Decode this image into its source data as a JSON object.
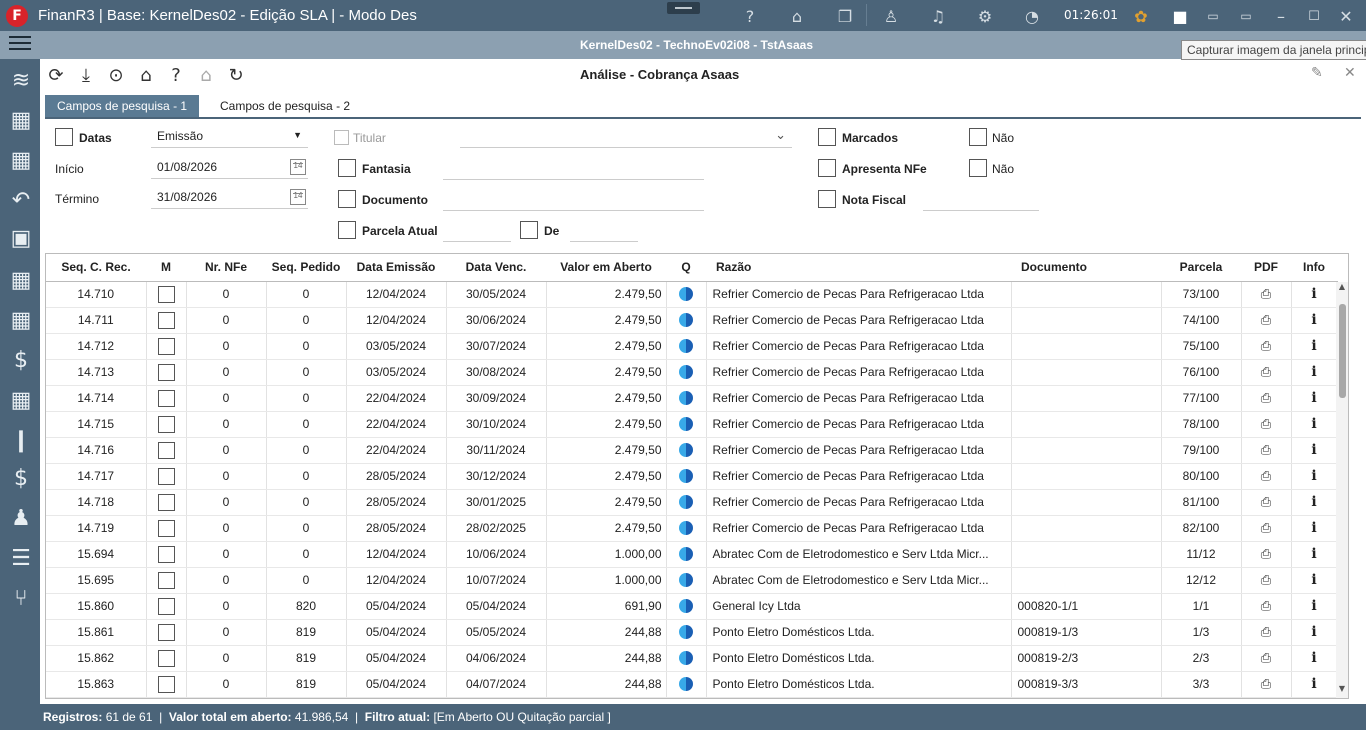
{
  "titlebar": {
    "app_title": "FinanR3 | Base: KernelDes02 - Edição SLA | - Modo Des",
    "logo_letter": "F",
    "clock": "01:26:01"
  },
  "subbar": {
    "title": "KernelDes02 - TechnoEv02i08 - TstAsaas",
    "tooltip": "Capturar imagem da janela principal"
  },
  "window": {
    "title": "Análise - Cobrança Asaas"
  },
  "tabs": [
    {
      "label": "Campos de pesquisa - 1"
    },
    {
      "label": "Campos de pesquisa - 2"
    }
  ],
  "filters": {
    "datas_label": "Datas",
    "date_type": "Emissão",
    "inicio_label": "Início",
    "inicio_value": "01/08/2026",
    "termino_label": "Término",
    "termino_value": "31/08/2026",
    "titular_label": "Titular",
    "fantasia_label": "Fantasia",
    "documento_label": "Documento",
    "parcela_label": "Parcela Atual",
    "de_label": "De",
    "marcados_label": "Marcados",
    "apresenta_label": "Apresenta NFe",
    "nota_label": "Nota Fiscal",
    "nao1_label": "Não",
    "nao2_label": "Não"
  },
  "grid": {
    "columns": [
      "Seq. C. Rec.",
      "M",
      "Nr. NFe",
      "Seq. Pedido",
      "Data Emissão",
      "Data Venc.",
      "Valor em Aberto",
      "Q",
      "Razão",
      "Documento",
      "Parcela",
      "PDF",
      "Info"
    ],
    "rows": [
      [
        "14.710",
        "0",
        "0",
        "12/04/2024",
        "30/05/2024",
        "2.479,50",
        "Refrier Comercio de Pecas Para Refrigeracao Ltda",
        "",
        "73/100"
      ],
      [
        "14.711",
        "0",
        "0",
        "12/04/2024",
        "30/06/2024",
        "2.479,50",
        "Refrier Comercio de Pecas Para Refrigeracao Ltda",
        "",
        "74/100"
      ],
      [
        "14.712",
        "0",
        "0",
        "03/05/2024",
        "30/07/2024",
        "2.479,50",
        "Refrier Comercio de Pecas Para Refrigeracao Ltda",
        "",
        "75/100"
      ],
      [
        "14.713",
        "0",
        "0",
        "03/05/2024",
        "30/08/2024",
        "2.479,50",
        "Refrier Comercio de Pecas Para Refrigeracao Ltda",
        "",
        "76/100"
      ],
      [
        "14.714",
        "0",
        "0",
        "22/04/2024",
        "30/09/2024",
        "2.479,50",
        "Refrier Comercio de Pecas Para Refrigeracao Ltda",
        "",
        "77/100"
      ],
      [
        "14.715",
        "0",
        "0",
        "22/04/2024",
        "30/10/2024",
        "2.479,50",
        "Refrier Comercio de Pecas Para Refrigeracao Ltda",
        "",
        "78/100"
      ],
      [
        "14.716",
        "0",
        "0",
        "22/04/2024",
        "30/11/2024",
        "2.479,50",
        "Refrier Comercio de Pecas Para Refrigeracao Ltda",
        "",
        "79/100"
      ],
      [
        "14.717",
        "0",
        "0",
        "28/05/2024",
        "30/12/2024",
        "2.479,50",
        "Refrier Comercio de Pecas Para Refrigeracao Ltda",
        "",
        "80/100"
      ],
      [
        "14.718",
        "0",
        "0",
        "28/05/2024",
        "30/01/2025",
        "2.479,50",
        "Refrier Comercio de Pecas Para Refrigeracao Ltda",
        "",
        "81/100"
      ],
      [
        "14.719",
        "0",
        "0",
        "28/05/2024",
        "28/02/2025",
        "2.479,50",
        "Refrier Comercio de Pecas Para Refrigeracao Ltda",
        "",
        "82/100"
      ],
      [
        "15.694",
        "0",
        "0",
        "12/04/2024",
        "10/06/2024",
        "1.000,00",
        "Abratec Com de Eletrodomestico e Serv Ltda Micr...",
        "",
        "11/12"
      ],
      [
        "15.695",
        "0",
        "0",
        "12/04/2024",
        "10/07/2024",
        "1.000,00",
        "Abratec Com de Eletrodomestico e Serv Ltda Micr...",
        "",
        "12/12"
      ],
      [
        "15.860",
        "0",
        "820",
        "05/04/2024",
        "05/04/2024",
        "691,90",
        "General Icy Ltda",
        "000820-1/1",
        "1/1"
      ],
      [
        "15.861",
        "0",
        "819",
        "05/04/2024",
        "05/05/2024",
        "244,88",
        "Ponto Eletro Domésticos Ltda.",
        "000819-1/3",
        "1/3"
      ],
      [
        "15.862",
        "0",
        "819",
        "05/04/2024",
        "04/06/2024",
        "244,88",
        "Ponto Eletro Domésticos Ltda.",
        "000819-2/3",
        "2/3"
      ],
      [
        "15.863",
        "0",
        "819",
        "05/04/2024",
        "04/07/2024",
        "244,88",
        "Ponto Eletro Domésticos Ltda.",
        "000819-3/3",
        "3/3"
      ]
    ]
  },
  "status": {
    "registros_label": "Registros:",
    "registros_value": "61 de 61",
    "valor_label": "Valor total em aberto:",
    "valor_value": "41.986,54",
    "filtro_label": "Filtro atual:",
    "filtro_value": "[Em Aberto OU Quitação parcial ]"
  }
}
